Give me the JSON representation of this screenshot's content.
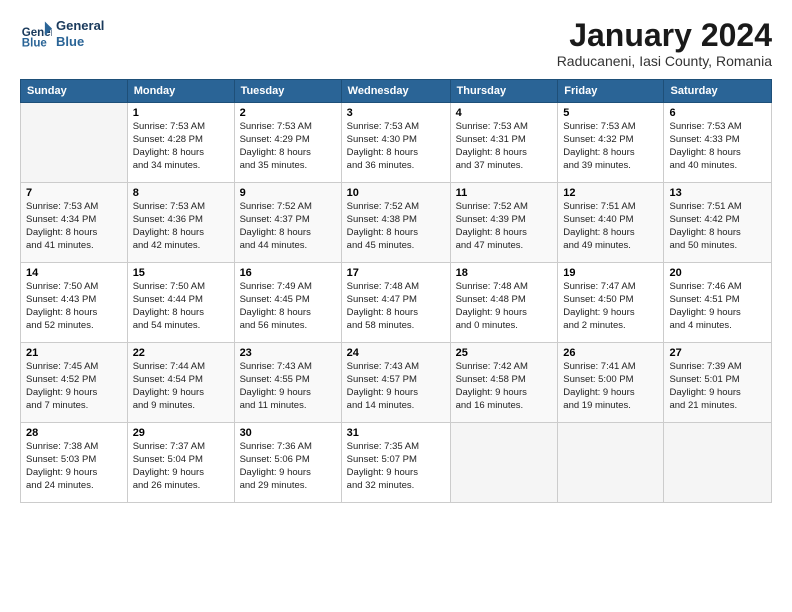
{
  "header": {
    "logo_line1": "General",
    "logo_line2": "Blue",
    "month": "January 2024",
    "location": "Raducaneni, Iasi County, Romania"
  },
  "weekdays": [
    "Sunday",
    "Monday",
    "Tuesday",
    "Wednesday",
    "Thursday",
    "Friday",
    "Saturday"
  ],
  "weeks": [
    [
      {
        "day": "",
        "info": ""
      },
      {
        "day": "1",
        "info": "Sunrise: 7:53 AM\nSunset: 4:28 PM\nDaylight: 8 hours\nand 34 minutes."
      },
      {
        "day": "2",
        "info": "Sunrise: 7:53 AM\nSunset: 4:29 PM\nDaylight: 8 hours\nand 35 minutes."
      },
      {
        "day": "3",
        "info": "Sunrise: 7:53 AM\nSunset: 4:30 PM\nDaylight: 8 hours\nand 36 minutes."
      },
      {
        "day": "4",
        "info": "Sunrise: 7:53 AM\nSunset: 4:31 PM\nDaylight: 8 hours\nand 37 minutes."
      },
      {
        "day": "5",
        "info": "Sunrise: 7:53 AM\nSunset: 4:32 PM\nDaylight: 8 hours\nand 39 minutes."
      },
      {
        "day": "6",
        "info": "Sunrise: 7:53 AM\nSunset: 4:33 PM\nDaylight: 8 hours\nand 40 minutes."
      }
    ],
    [
      {
        "day": "7",
        "info": "Sunrise: 7:53 AM\nSunset: 4:34 PM\nDaylight: 8 hours\nand 41 minutes."
      },
      {
        "day": "8",
        "info": "Sunrise: 7:53 AM\nSunset: 4:36 PM\nDaylight: 8 hours\nand 42 minutes."
      },
      {
        "day": "9",
        "info": "Sunrise: 7:52 AM\nSunset: 4:37 PM\nDaylight: 8 hours\nand 44 minutes."
      },
      {
        "day": "10",
        "info": "Sunrise: 7:52 AM\nSunset: 4:38 PM\nDaylight: 8 hours\nand 45 minutes."
      },
      {
        "day": "11",
        "info": "Sunrise: 7:52 AM\nSunset: 4:39 PM\nDaylight: 8 hours\nand 47 minutes."
      },
      {
        "day": "12",
        "info": "Sunrise: 7:51 AM\nSunset: 4:40 PM\nDaylight: 8 hours\nand 49 minutes."
      },
      {
        "day": "13",
        "info": "Sunrise: 7:51 AM\nSunset: 4:42 PM\nDaylight: 8 hours\nand 50 minutes."
      }
    ],
    [
      {
        "day": "14",
        "info": "Sunrise: 7:50 AM\nSunset: 4:43 PM\nDaylight: 8 hours\nand 52 minutes."
      },
      {
        "day": "15",
        "info": "Sunrise: 7:50 AM\nSunset: 4:44 PM\nDaylight: 8 hours\nand 54 minutes."
      },
      {
        "day": "16",
        "info": "Sunrise: 7:49 AM\nSunset: 4:45 PM\nDaylight: 8 hours\nand 56 minutes."
      },
      {
        "day": "17",
        "info": "Sunrise: 7:48 AM\nSunset: 4:47 PM\nDaylight: 8 hours\nand 58 minutes."
      },
      {
        "day": "18",
        "info": "Sunrise: 7:48 AM\nSunset: 4:48 PM\nDaylight: 9 hours\nand 0 minutes."
      },
      {
        "day": "19",
        "info": "Sunrise: 7:47 AM\nSunset: 4:50 PM\nDaylight: 9 hours\nand 2 minutes."
      },
      {
        "day": "20",
        "info": "Sunrise: 7:46 AM\nSunset: 4:51 PM\nDaylight: 9 hours\nand 4 minutes."
      }
    ],
    [
      {
        "day": "21",
        "info": "Sunrise: 7:45 AM\nSunset: 4:52 PM\nDaylight: 9 hours\nand 7 minutes."
      },
      {
        "day": "22",
        "info": "Sunrise: 7:44 AM\nSunset: 4:54 PM\nDaylight: 9 hours\nand 9 minutes."
      },
      {
        "day": "23",
        "info": "Sunrise: 7:43 AM\nSunset: 4:55 PM\nDaylight: 9 hours\nand 11 minutes."
      },
      {
        "day": "24",
        "info": "Sunrise: 7:43 AM\nSunset: 4:57 PM\nDaylight: 9 hours\nand 14 minutes."
      },
      {
        "day": "25",
        "info": "Sunrise: 7:42 AM\nSunset: 4:58 PM\nDaylight: 9 hours\nand 16 minutes."
      },
      {
        "day": "26",
        "info": "Sunrise: 7:41 AM\nSunset: 5:00 PM\nDaylight: 9 hours\nand 19 minutes."
      },
      {
        "day": "27",
        "info": "Sunrise: 7:39 AM\nSunset: 5:01 PM\nDaylight: 9 hours\nand 21 minutes."
      }
    ],
    [
      {
        "day": "28",
        "info": "Sunrise: 7:38 AM\nSunset: 5:03 PM\nDaylight: 9 hours\nand 24 minutes."
      },
      {
        "day": "29",
        "info": "Sunrise: 7:37 AM\nSunset: 5:04 PM\nDaylight: 9 hours\nand 26 minutes."
      },
      {
        "day": "30",
        "info": "Sunrise: 7:36 AM\nSunset: 5:06 PM\nDaylight: 9 hours\nand 29 minutes."
      },
      {
        "day": "31",
        "info": "Sunrise: 7:35 AM\nSunset: 5:07 PM\nDaylight: 9 hours\nand 32 minutes."
      },
      {
        "day": "",
        "info": ""
      },
      {
        "day": "",
        "info": ""
      },
      {
        "day": "",
        "info": ""
      }
    ]
  ]
}
